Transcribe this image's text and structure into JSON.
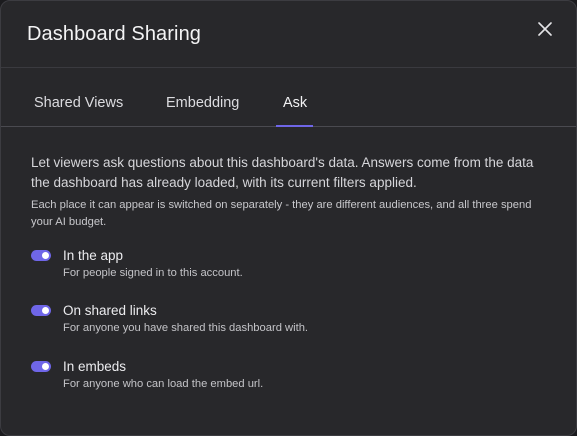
{
  "dialog": {
    "title": "Dashboard Sharing",
    "close_icon": "close-icon"
  },
  "tabs": [
    {
      "label": "Shared Views",
      "active": false
    },
    {
      "label": "Embedding",
      "active": false
    },
    {
      "label": "Ask",
      "active": true
    }
  ],
  "ask": {
    "intro": "Let viewers ask questions about this dashboard's data. Answers come from the data the dashboard has already loaded, with its current filters applied.",
    "note": "Each place it can appear is switched on separately - they are different audiences, and all three spend your AI budget.",
    "options": [
      {
        "label": "In the app",
        "description": "For people signed in to this account.",
        "enabled": true
      },
      {
        "label": "On shared links",
        "description": "For anyone you have shared this dashboard with.",
        "enabled": true
      },
      {
        "label": "In embeds",
        "description": "For anyone who can load the embed url.",
        "enabled": true
      }
    ]
  },
  "colors": {
    "accent": "#6f66e8",
    "background": "#28282b"
  }
}
